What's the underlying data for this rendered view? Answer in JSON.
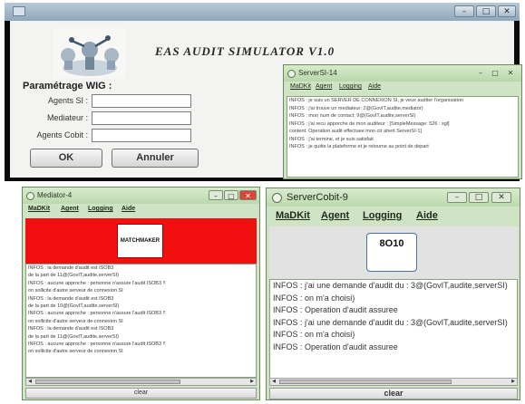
{
  "main_window": {
    "app_title": "EAS AUDIT SIMULATOR V1.0",
    "controls": {
      "minimize": "–",
      "maximize": "□",
      "close": "✕"
    },
    "form": {
      "title": "Paramétrage WIG :",
      "fields": [
        {
          "label": "Agents SI :",
          "value": ""
        },
        {
          "label": "Mediateur :",
          "value": ""
        },
        {
          "label": "Agents Cobit :",
          "value": ""
        }
      ],
      "ok_label": "OK",
      "cancel_label": "Annuler"
    }
  },
  "server_si": {
    "title": "ServerSI-14",
    "controls": {
      "minimize": "–",
      "maximize": "□",
      "close": "✕"
    },
    "menu": [
      "MaDKit",
      "Agent",
      "Logging",
      "Aide"
    ],
    "log": [
      "INFOS : je suis un SERVER DE CONNEXION SI, je veux auditer l'organisation",
      "INFOS : j'ai trouve un mediateur: 2@(GovIT,audite,mediator)",
      "INFOS : mon num de contact: 9@(GovIT,audite,serverSI)",
      "INFOS : j'ai recu apporche de mon auditeur : [SimpleMessage: 526 : sgl]",
      "          content: Operation audit effectuee mon ctr ahert ServerSI-1]",
      "INFOS : j'ai termine, et je suis satisfait",
      "INFOS : je quitte la plateforme et je retourne au point de depart"
    ]
  },
  "mediator": {
    "title": "Mediator-4",
    "controls": {
      "minimize": "–",
      "maximize": "□",
      "close": "✕"
    },
    "menu": [
      "MaDKit",
      "Agent",
      "Logging",
      "Aide"
    ],
    "agent_label": "MATCHMAKER",
    "log": [
      "INFOS : la demande d'audit est ISOB3",
      "de la part de 11@(GovIT,audite,serverSI)",
      "INFOS : aucune approche : personne n'assure l'audit ISOB3 !!",
      "on sollicite d'autre serveur de connexion SI",
      "INFOS : la demande d'audit est ISOB3",
      "de la part de 10@(GovIT,audite,serverSI)",
      "INFOS : aucune approche : personne n'assure l'audit ISOB3 !!",
      "on sollicite d'autre serveur de connexion SI",
      "INFOS : la demande d'audit est ISOB3",
      "de la part de 11@(GovIT,audite,serverSI)",
      "INFOS : aucune approche : personne n'assure l'audit ISOB3 !!",
      "on sollicite d'autre serveur de connexion SI"
    ],
    "clear_label": "clear",
    "scroll_left": "◀",
    "scroll_right": "▶"
  },
  "server_cobit": {
    "title": "ServerCobit-9",
    "controls": {
      "minimize": "–",
      "maximize": "□",
      "close": "✕"
    },
    "menu": [
      "MaDKit",
      "Agent",
      "Logging",
      "Aide"
    ],
    "agent_label": "8O10",
    "log": [
      "INFOS : j'ai une demande d'audit du : 3@(GovIT,audite,serverSI)",
      "INFOS : on m'a choisi)",
      "INFOS : Operation d'audit assuree",
      "INFOS : j'ai une demande d'audit du : 3@(GovIT,audite,serverSI)",
      "INFOS : on m'a choisi)",
      "INFOS : Operation d'audit assuree"
    ],
    "clear_label": "clear",
    "scroll_left": "◀",
    "scroll_right": "▶"
  }
}
